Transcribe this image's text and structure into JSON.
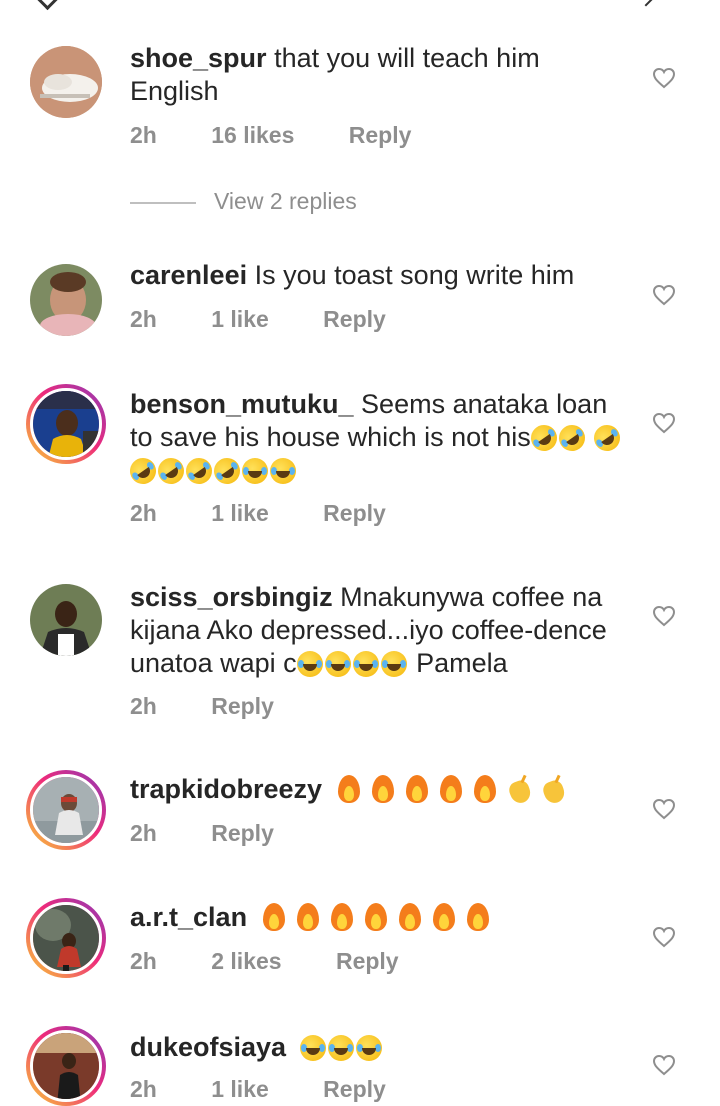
{
  "view_replies_label": "View 2 replies",
  "comments": [
    {
      "username": "shoe_spur",
      "text": "that you will teach him English",
      "time": "2h",
      "likes": "16 likes",
      "reply": "Reply",
      "avatar": {
        "bg": "#c89a7a",
        "fg": "#ffffff"
      }
    },
    {
      "username": "carenleei",
      "text": "Is you toast song write him",
      "time": "2h",
      "likes": "1 like",
      "reply": "Reply",
      "avatar": {
        "bg": "#c9a07f",
        "fg": "#8b5a3c"
      }
    },
    {
      "username": "benson_mutuku_",
      "text": "Seems anataka loan to save his house which is not his",
      "time": "2h",
      "likes": "1 like",
      "reply": "Reply",
      "avatar": {
        "bg": "#1e3f8a",
        "fg": "#e5b800"
      }
    },
    {
      "username": "sciss_orsbingiz",
      "text": "Mnakunywa coffee na kijana Ako depressed...iyo coffee-dence unatoa wapi c",
      "text_tail": "Pamela",
      "time": "2h",
      "reply": "Reply",
      "avatar": {
        "bg": "#6b7a5a",
        "fg": "#2a2a2a"
      }
    },
    {
      "username": "trapkidobreezy",
      "time": "2h",
      "reply": "Reply",
      "avatar": {
        "bg": "#9aa5a8",
        "fg": "#d34b3a"
      }
    },
    {
      "username": "a.r.t_clan",
      "time": "2h",
      "likes": "2 likes",
      "reply": "Reply",
      "avatar": {
        "bg": "#4a4f4a",
        "fg": "#c0392b"
      }
    },
    {
      "username": "dukeofsiaya",
      "time": "2h",
      "likes": "1 like",
      "reply": "Reply",
      "avatar": {
        "bg": "#7a3a2a",
        "fg": "#1a1a1a"
      }
    }
  ]
}
